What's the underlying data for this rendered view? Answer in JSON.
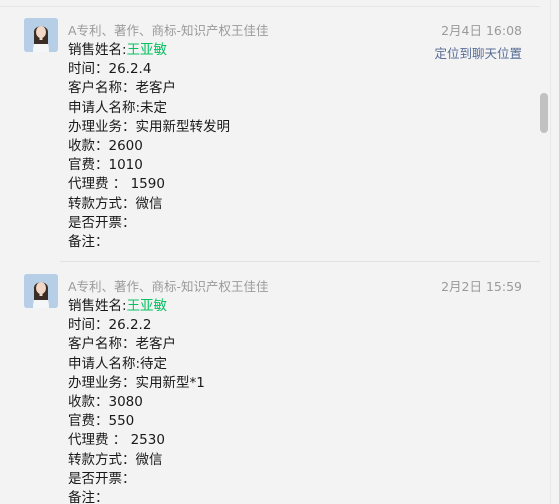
{
  "messages": [
    {
      "sender": "A专利、著作、商标-知识产权王佳佳",
      "time": "2月4日 16:08",
      "locate_label": "定位到聊天位置",
      "lines": {
        "sales_label": "销售姓名:",
        "sales_name": "王亚敏",
        "date": "时间：26.2.4",
        "customer": "客户名称：老客户",
        "applicant": "申请人名称:未定",
        "business": "办理业务：实用新型转发明",
        "receipt": "收款：2600",
        "official_fee": "官费：1010",
        "agency_fee": "代理费 ： 1590",
        "payment": "转款方式：微信",
        "invoice": "是否开票：",
        "remark": "备注："
      }
    },
    {
      "sender": "A专利、著作、商标-知识产权王佳佳",
      "time": "2月2日 15:59",
      "lines": {
        "sales_label": "销售姓名:",
        "sales_name": "王亚敏",
        "date": "时间：26.2.2",
        "customer": "客户名称：老客户",
        "applicant": "申请人名称:待定",
        "business": "办理业务：实用新型*1",
        "receipt": "收款：3080",
        "official_fee": "官费：550",
        "agency_fee": "代理费 ： 2530",
        "payment": "转款方式：微信",
        "invoice": "是否开票：",
        "remark": "备注："
      }
    }
  ],
  "colors": {
    "background": "#f3f3f3",
    "highlight": "#07c160",
    "link": "#576b95",
    "meta_text": "#9a9a9a"
  }
}
